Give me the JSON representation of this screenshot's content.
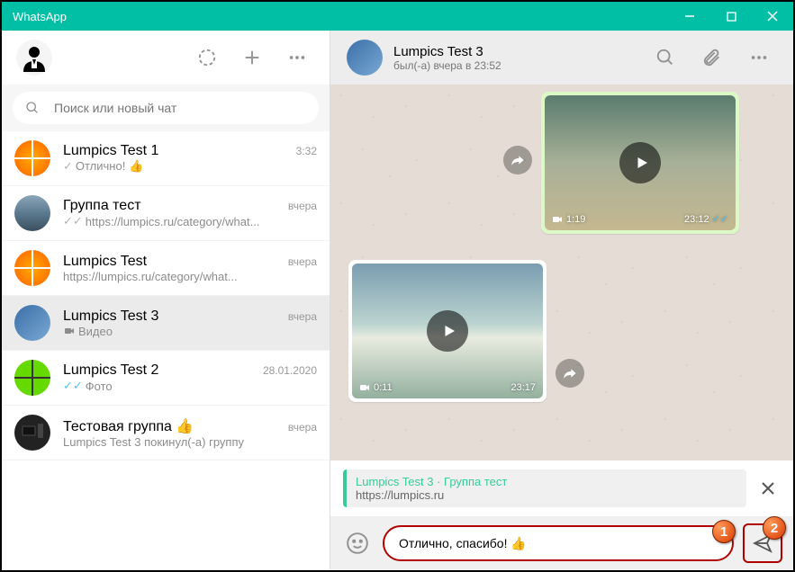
{
  "window": {
    "title": "WhatsApp"
  },
  "left": {
    "search_placeholder": "Поиск или новый чат",
    "chats": [
      {
        "name": "Lumpics Test 1",
        "time": "3:32",
        "preview": "Отлично! 👍",
        "check": "single"
      },
      {
        "name": "Группа тест",
        "time": "вчера",
        "preview": "https://lumpics.ru/category/what...",
        "check": "double"
      },
      {
        "name": "Lumpics Test",
        "time": "вчера",
        "preview": "https://lumpics.ru/category/what...",
        "check": "none"
      },
      {
        "name": "Lumpics Test 3",
        "time": "вчера",
        "preview": "Видео",
        "check": "none",
        "icon": "video",
        "selected": true
      },
      {
        "name": "Lumpics Test 2",
        "time": "28.01.2020",
        "preview": "Фото",
        "check": "read",
        "icon": "photo"
      },
      {
        "name": "Тестовая группа 👍",
        "time": "вчера",
        "preview": "Lumpics Test 3 покинул(-а) группу",
        "check": "none"
      }
    ]
  },
  "right": {
    "header": {
      "name": "Lumpics Test 3",
      "status": "был(-а) вчера в 23:52"
    },
    "messages": [
      {
        "type": "out",
        "duration": "1:19",
        "time": "23:12",
        "read": true
      },
      {
        "type": "in",
        "duration": "0:11",
        "time": "23:17"
      }
    ],
    "quote": {
      "title": "Lumpics Test 3 · Группа тест",
      "text": "https://lumpics.ru"
    },
    "input_value": "Отлично, спасибо! 👍"
  },
  "callouts": {
    "one": "1",
    "two": "2"
  }
}
